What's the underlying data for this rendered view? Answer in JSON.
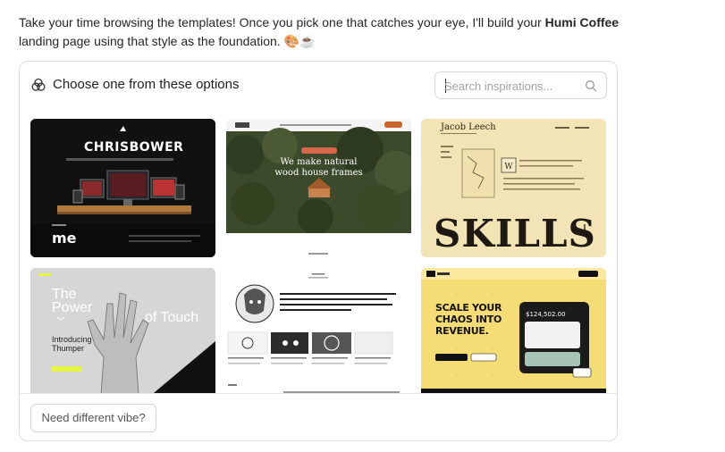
{
  "intro": {
    "text_before": "Take your time browsing the templates! Once you pick one that catches your eye, I'll build your ",
    "brand": "Humi Coffee",
    "text_after": " landing page using that style as the foundation. ",
    "emoji": "🎨☕"
  },
  "panel": {
    "title": "Choose one from these options",
    "icon": "palette-icon",
    "search": {
      "placeholder": "Search inspirations...",
      "value": "",
      "icon": "search-icon"
    }
  },
  "templates": [
    {
      "id": "chrisbower",
      "headline": "CHRISBOWER",
      "sub": "me"
    },
    {
      "id": "house-frames",
      "headline": "We make natural wood house frames"
    },
    {
      "id": "jacob-leech",
      "name": "Jacob Leech",
      "headline": "SKILLS"
    },
    {
      "id": "power-of-touch",
      "headline_a": "The Power",
      "headline_b": "of Touch",
      "sub": "Introducing Thumper"
    },
    {
      "id": "illustrated-portfolio",
      "headline": ""
    },
    {
      "id": "scale-chaos",
      "headline": "SCALE YOUR CHAOS INTO REVENUE.",
      "figure": "$124,502.00"
    }
  ],
  "footer": {
    "button_label": "Need different vibe?"
  },
  "colors": {
    "border": "#dedede",
    "accent_yellow": "#f6dc74",
    "lime": "#e4f542"
  }
}
